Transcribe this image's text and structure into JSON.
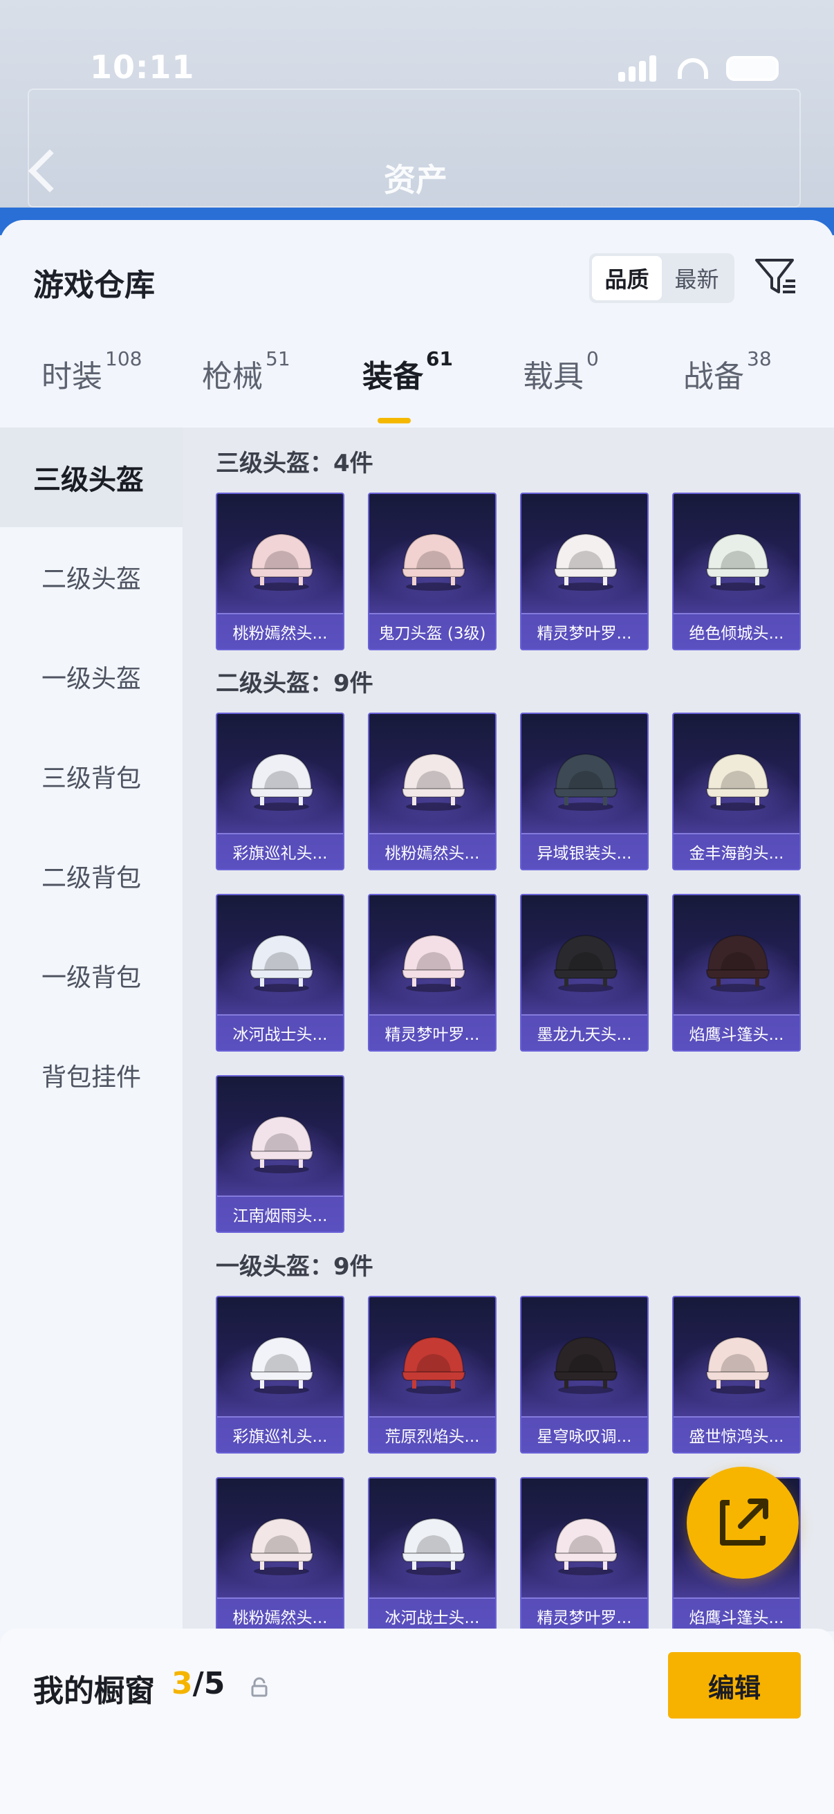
{
  "status_bar": {
    "time": "10:11"
  },
  "header": {
    "title": "资产"
  },
  "sheet": {
    "title": "游戏仓库",
    "sort": [
      "品质",
      "最新"
    ],
    "active_sort": "品质"
  },
  "tabs": [
    {
      "label": "时装",
      "count": "108"
    },
    {
      "label": "枪械",
      "count": "51"
    },
    {
      "label": "装备",
      "count": "61"
    },
    {
      "label": "载具",
      "count": "0"
    },
    {
      "label": "战备",
      "count": "38"
    }
  ],
  "active_tab": "装备",
  "side_menu": [
    "三级头盔",
    "二级头盔",
    "一级头盔",
    "三级背包",
    "二级背包",
    "一级背包",
    "背包挂件"
  ],
  "sections": [
    {
      "heading": "三级头盔：4件",
      "items": [
        "桃粉嫣然头...",
        "鬼刀头盔 (3级)",
        "精灵梦叶罗...",
        "绝色倾城头..."
      ]
    },
    {
      "heading": "二级头盔：9件",
      "items": [
        "彩旗巡礼头...",
        "桃粉嫣然头...",
        "异域银装头...",
        "金丰海韵头...",
        "冰河战士头...",
        "精灵梦叶罗...",
        "墨龙九天头...",
        "焰鹰斗篷头...",
        "江南烟雨头..."
      ]
    },
    {
      "heading": "一级头盔：9件",
      "items": [
        "彩旗巡礼头...",
        "荒原烈焰头...",
        "星穹咏叹调...",
        "盛世惊鸿头...",
        "桃粉嫣然头...",
        "冰河战士头...",
        "精灵梦叶罗...",
        "焰鹰斗篷头..."
      ]
    }
  ],
  "helmet_colors": {
    "s0": [
      "#f1d4d6",
      "#f1d2d0",
      "#f4f0f0",
      "#e8efe8"
    ],
    "s1": [
      "#eef0f6",
      "#f2e8e8",
      "#3d4a55",
      "#f0ead8",
      "#e9eef6",
      "#f4dfe6",
      "#2a2a2e",
      "#3a2428",
      "#f2e2ea"
    ],
    "s2": [
      "#f2f3f8",
      "#c63a34",
      "#2a2426",
      "#f3ddd8",
      "#f2e6e6",
      "#eef1f5",
      "#f4e6ea",
      "#3a2428"
    ]
  },
  "bottom_bar": {
    "label": "我的橱窗",
    "count_current": "3",
    "count_total": "/5",
    "edit_label": "编辑"
  },
  "colors": {
    "accent": "#f5b800",
    "card_top": "#171a3a",
    "card_bottom": "#5e52c4"
  }
}
